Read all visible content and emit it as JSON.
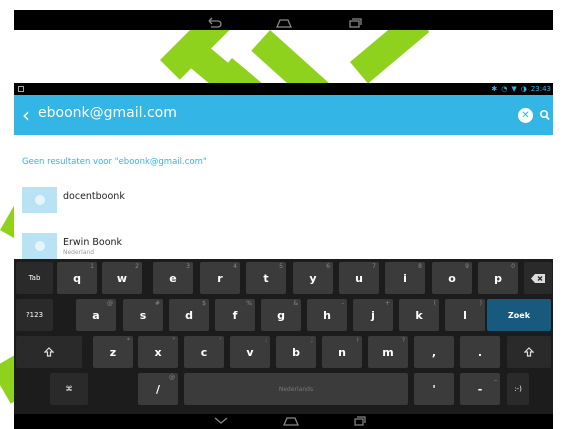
{
  "search": {
    "query": "eboonk@gmail.com"
  },
  "status_bar": {
    "time": "23:43"
  },
  "results": {
    "no_results_text": "Geen resultaten voor \"eboonk@gmail.com\"",
    "contacts": [
      {
        "name": "docentboonk",
        "sub": ""
      },
      {
        "name": "Erwin Boonk",
        "sub": "Nederland"
      }
    ]
  },
  "keyboard": {
    "row1": [
      {
        "label": "Tab",
        "hint": ""
      },
      {
        "label": "q",
        "hint": "1"
      },
      {
        "label": "w",
        "hint": "2"
      },
      {
        "label": "e",
        "hint": "3"
      },
      {
        "label": "r",
        "hint": "4"
      },
      {
        "label": "t",
        "hint": "5"
      },
      {
        "label": "y",
        "hint": "6"
      },
      {
        "label": "u",
        "hint": "7"
      },
      {
        "label": "i",
        "hint": "8"
      },
      {
        "label": "o",
        "hint": "9"
      },
      {
        "label": "p",
        "hint": "0"
      }
    ],
    "row2": [
      {
        "label": "?123",
        "hint": ""
      },
      {
        "label": "a",
        "hint": "@"
      },
      {
        "label": "s",
        "hint": "#"
      },
      {
        "label": "d",
        "hint": "$"
      },
      {
        "label": "f",
        "hint": "%"
      },
      {
        "label": "g",
        "hint": "&"
      },
      {
        "label": "h",
        "hint": "-"
      },
      {
        "label": "j",
        "hint": "+"
      },
      {
        "label": "k",
        "hint": "("
      },
      {
        "label": "l",
        "hint": ")"
      },
      {
        "label": "Zoek",
        "hint": ""
      }
    ],
    "row3": [
      {
        "label": "z",
        "hint": "*"
      },
      {
        "label": "x",
        "hint": "\""
      },
      {
        "label": "c",
        "hint": "'"
      },
      {
        "label": "v",
        "hint": ":"
      },
      {
        "label": "b",
        "hint": ";"
      },
      {
        "label": "n",
        "hint": "!"
      },
      {
        "label": "m",
        "hint": "?"
      },
      {
        "label": ",",
        "hint": ""
      },
      {
        "label": ".",
        "hint": ""
      }
    ],
    "row4": {
      "lang_key": "⌘",
      "slash": "/",
      "slash_hint": "@",
      "space": "Nederlands",
      "apostrophe": "'",
      "dash": "-",
      "dash_hint": "_",
      "smiley": ":-)"
    }
  },
  "colors": {
    "accent": "#33b5e5",
    "stripe": "#8ed21e",
    "keyboard_bg": "#1c1c1c",
    "key": "#3b3b3b",
    "action_key": "#175a7d"
  }
}
